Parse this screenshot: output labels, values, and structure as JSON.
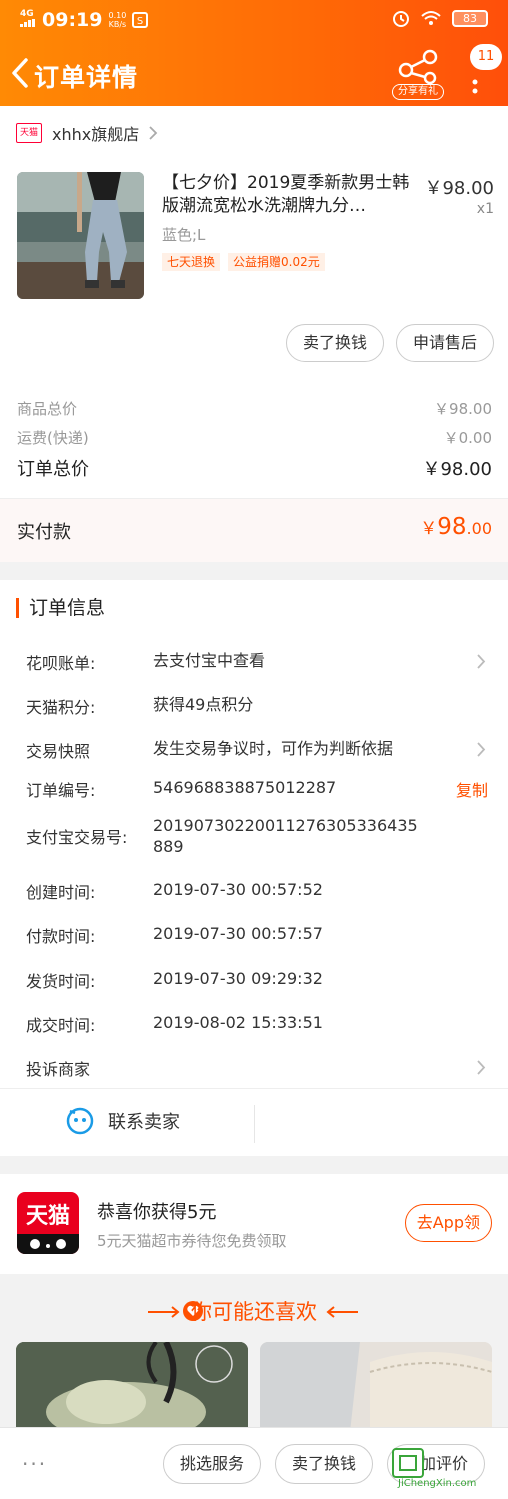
{
  "status_bar": {
    "network": "4G",
    "time": "09:19",
    "speed_value": "0.10",
    "speed_unit": "KB/s",
    "battery": "83"
  },
  "nav": {
    "title": "订单详情",
    "share_label": "分享有礼",
    "badge_count": "11"
  },
  "shop": {
    "mini_logo_text": "天猫",
    "name": "xhhx旗舰店"
  },
  "product": {
    "title": "【七夕价】2019夏季新款男士韩版潮流宽松水洗潮牌九分…",
    "price": "￥98.00",
    "qty": "x1",
    "sku": "蓝色;L",
    "tags": [
      "七天退换",
      "公益捐赠0.02元"
    ]
  },
  "order_buttons": {
    "sell": "卖了换钱",
    "after_sale": "申请售后"
  },
  "summary": {
    "goods_label": "商品总价",
    "goods_value": "￥98.00",
    "shipping_label": "运费(快递)",
    "shipping_value": "￥0.00",
    "total_label": "订单总价",
    "total_value": "￥98.00",
    "paid_label": "实付款",
    "paid_currency": "￥",
    "paid_int": "98",
    "paid_dec": ".00"
  },
  "order_info": {
    "title": "订单信息",
    "rows": [
      {
        "k": "花呗账单:",
        "v": "去支付宝中查看"
      },
      {
        "k": "天猫积分:",
        "v": "获得49点积分"
      },
      {
        "k": "交易快照",
        "v": "发生交易争议时，可作为判断依据"
      },
      {
        "k": "订单编号:",
        "v": "546968838875012287",
        "action": "复制"
      },
      {
        "k": "支付宝交易号:",
        "v": "20190730220011276305336435889"
      },
      {
        "k": "创建时间:",
        "v": "2019-07-30 00:57:52"
      },
      {
        "k": "付款时间:",
        "v": "2019-07-30 00:57:57"
      },
      {
        "k": "发货时间:",
        "v": "2019-07-30 09:29:32"
      },
      {
        "k": "成交时间:",
        "v": "2019-08-02 15:33:51"
      },
      {
        "k": "投诉商家",
        "v": ""
      }
    ]
  },
  "contact": {
    "label": "联系卖家"
  },
  "coupon": {
    "logo_text": "天猫",
    "title": "恭喜你获得5元",
    "subtitle": "5元天猫超市券待您免费领取",
    "button": "去App领"
  },
  "recommend": {
    "title": "你可能还喜欢"
  },
  "bottom_bar": {
    "more": "···",
    "select_service": "挑选服务",
    "sell": "卖了换钱",
    "review": "追加评价"
  },
  "watermark": {
    "text": "JiChengXin.com"
  },
  "colors": {
    "accent": "#ff5000",
    "header_start": "#ff8a05",
    "header_end": "#ff4f0a",
    "tmall_red": "#e9001e"
  }
}
